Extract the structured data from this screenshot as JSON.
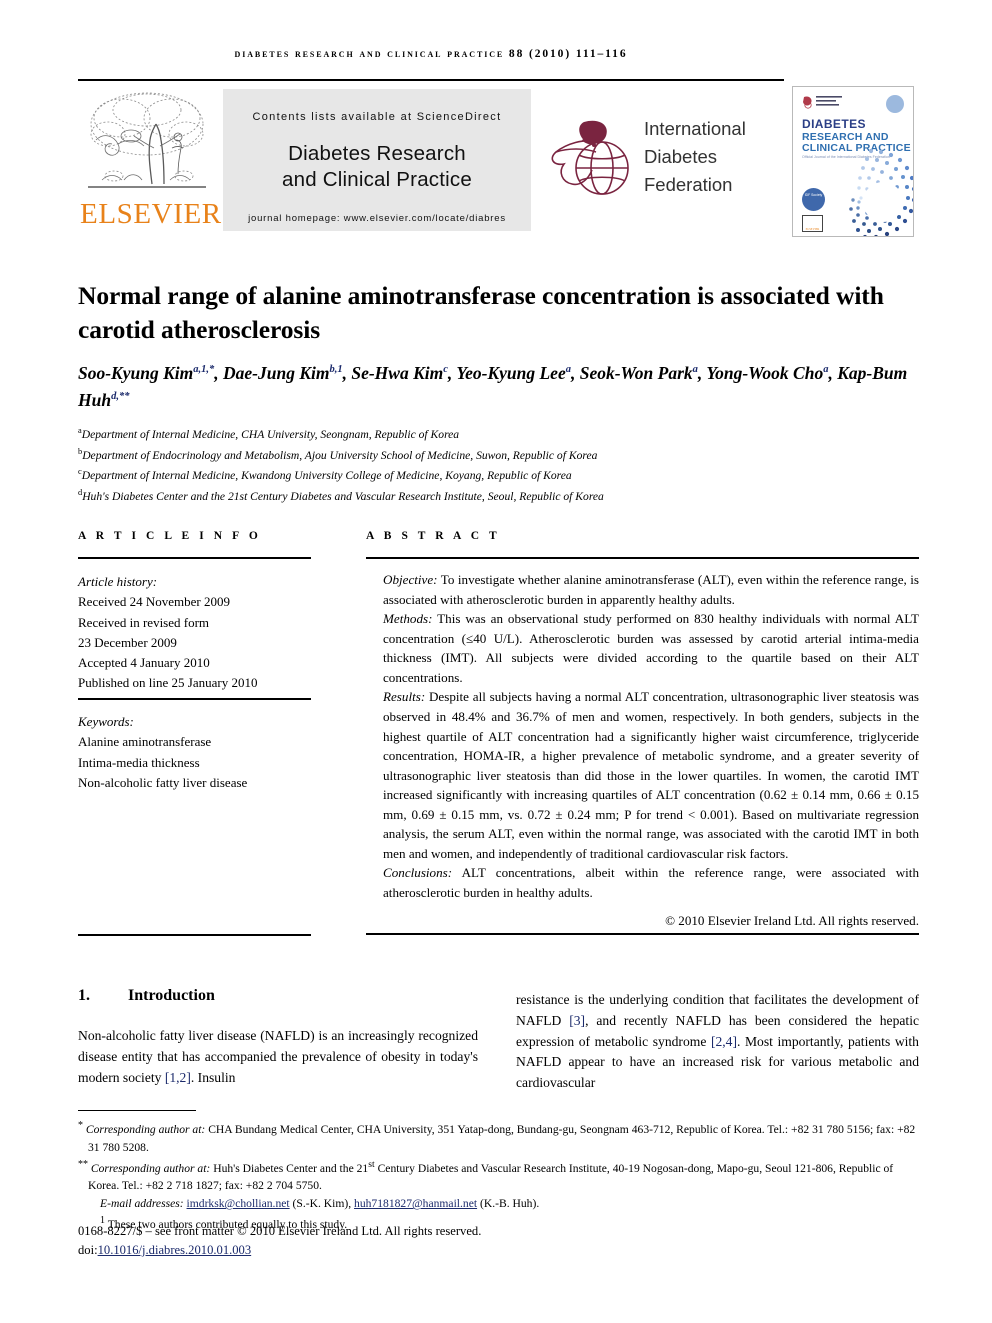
{
  "running_head": "Diabetes Research and Clinical Practice 88 (2010) 111–116",
  "masthead": {
    "sciencedirect_line": "Contents lists available at ScienceDirect",
    "journal_title_line1": "Diabetes Research",
    "journal_title_line2": "and Clinical Practice",
    "homepage_line": "journal homepage: www.elsevier.com/locate/diabres",
    "publisher_wordmark": "ELSEVIER",
    "idf_line1": "International",
    "idf_line2": "Diabetes",
    "idf_line3": "Federation",
    "cover": {
      "line1": "DIABETES",
      "line2": "RESEARCH AND",
      "line3": "CLINICAL PRACTICE",
      "line4": "Official Journal of the International Diabetes Federation",
      "badge": "IDF Society",
      "publisher": "ELSEVIER"
    }
  },
  "article": {
    "title": "Normal range of alanine aminotransferase concentration is associated with carotid atherosclerosis",
    "authors_line1_prefix": "Soo-Kyung Kim",
    "authors": [
      {
        "name": "Soo-Kyung Kim",
        "sup": "a,1,*"
      },
      {
        "name": "Dae-Jung Kim",
        "sup": "b,1"
      },
      {
        "name": "Se-Hwa Kim",
        "sup": "c"
      },
      {
        "name": "Yeo-Kyung Lee",
        "sup": "a"
      },
      {
        "name": "Seok-Won Park",
        "sup": "a"
      },
      {
        "name": "Yong-Wook Cho",
        "sup": "a"
      },
      {
        "name": "Kap-Bum Huh",
        "sup": "d,**"
      }
    ],
    "affiliations": [
      {
        "mark": "a",
        "text": "Department of Internal Medicine, CHA University, Seongnam, Republic of Korea"
      },
      {
        "mark": "b",
        "text": "Department of Endocrinology and Metabolism, Ajou University School of Medicine, Suwon, Republic of Korea"
      },
      {
        "mark": "c",
        "text": "Department of Internal Medicine, Kwandong University College of Medicine, Koyang, Republic of Korea"
      },
      {
        "mark": "d",
        "text": "Huh's Diabetes Center and the 21st Century Diabetes and Vascular Research Institute, Seoul, Republic of Korea"
      }
    ]
  },
  "article_info": {
    "heading": "A R T I C L E   I N F O",
    "history_label": "Article history:",
    "history": [
      "Received 24 November 2009",
      "Received in revised form",
      "23 December 2009",
      "Accepted 4 January 2010",
      "Published on line 25 January 2010"
    ],
    "keywords_label": "Keywords:",
    "keywords": [
      "Alanine aminotransferase",
      "Intima-media thickness",
      "Non-alcoholic fatty liver disease"
    ]
  },
  "abstract": {
    "heading": "A B S T R A C T",
    "objective_label": "Objective:",
    "objective_text": " To investigate whether alanine aminotransferase (ALT), even within the reference range, is associated with atherosclerotic burden in apparently healthy adults.",
    "methods_label": "Methods:",
    "methods_text": " This was an observational study performed on 830 healthy individuals with normal ALT concentration (≤40 U/L). Atherosclerotic burden was assessed by carotid arterial intima-media thickness (IMT). All subjects were divided according to the quartile based on their ALT concentrations.",
    "results_label": "Results:",
    "results_text": " Despite all subjects having a normal ALT concentration, ultrasonographic liver steatosis was observed in 48.4% and 36.7% of men and women, respectively. In both genders, subjects in the highest quartile of ALT concentration had a significantly higher waist circumference, triglyceride concentration, HOMA-IR, a higher prevalence of metabolic syndrome, and a greater severity of ultrasonographic liver steatosis than did those in the lower quartiles. In women, the carotid IMT increased significantly with increasing quartiles of ALT concentration (0.62 ± 0.14 mm, 0.66 ± 0.15 mm, 0.69 ± 0.15 mm, vs. 0.72 ± 0.24 mm; P for trend < 0.001). Based on multivariate regression analysis, the serum ALT, even within the normal range, was associated with the carotid IMT in both men and women, and independently of traditional cardiovascular risk factors.",
    "conclusions_label": "Conclusions:",
    "conclusions_text": " ALT concentrations, albeit within the reference range, were associated with atherosclerotic burden in healthy adults.",
    "copyright": "© 2010 Elsevier Ireland Ltd. All rights reserved."
  },
  "body": {
    "section_number": "1.",
    "section_title": "Introduction",
    "left_col_a": "Non-alcoholic fatty liver disease (NAFLD) is an increasingly recognized disease entity that has accompanied the prevalence of obesity in today's modern society ",
    "left_ref_1": "[1,2]",
    "left_col_b": ". Insulin",
    "right_col_a": "resistance is the underlying condition that facilitates the development of NAFLD ",
    "right_ref_1": "[3]",
    "right_col_b": ", and recently NAFLD has been considered the hepatic expression of metabolic syndrome ",
    "right_ref_2": "[2,4]",
    "right_col_c": ". Most importantly, patients with NAFLD appear to have an increased risk for various metabolic and cardiovascular"
  },
  "footnotes": {
    "fn1_mark": "*",
    "fn1_label": "Corresponding author at:",
    "fn1_text": " CHA Bundang Medical Center, CHA University, 351 Yatap-dong, Bundang-gu, Seongnam 463-712, Republic of Korea. Tel.: +82 31 780 5156; fax: +82 31 780 5208.",
    "fn2_mark": "**",
    "fn2_label": "Corresponding author at:",
    "fn2_text_a": " Huh's Diabetes Center and the 21",
    "fn2_sup": "st",
    "fn2_text_b": " Century Diabetes and Vascular Research Institute, 40-19 Nogosan-dong, Mapo-gu, Seoul 121-806, Republic of Korea. Tel.: +82 2 718 1827; fax: +82 2 704 5750.",
    "email_label": "E-mail addresses:",
    "email1": "imdrksk@chollian.net",
    "email1_owner": " (S.-K. Kim), ",
    "email2": "huh7181827@hanmail.net",
    "email2_owner": " (K.-B. Huh).",
    "fn3_mark": "1",
    "fn3_text": " These two authors contributed equally to this study."
  },
  "imprint": {
    "issn_line": "0168-8227/$ – see front matter © 2010 Elsevier Ireland Ltd. All rights reserved.",
    "doi_label": "doi:",
    "doi_value": "10.1016/j.diabres.2010.01.003"
  },
  "colors": {
    "elsevier_orange": "#E8821A",
    "link_navy": "#1b2a6b",
    "cover_blue": "#2b3f86",
    "idf_maroon": "#7a2440",
    "sd_gray": "#e7e7e7"
  }
}
